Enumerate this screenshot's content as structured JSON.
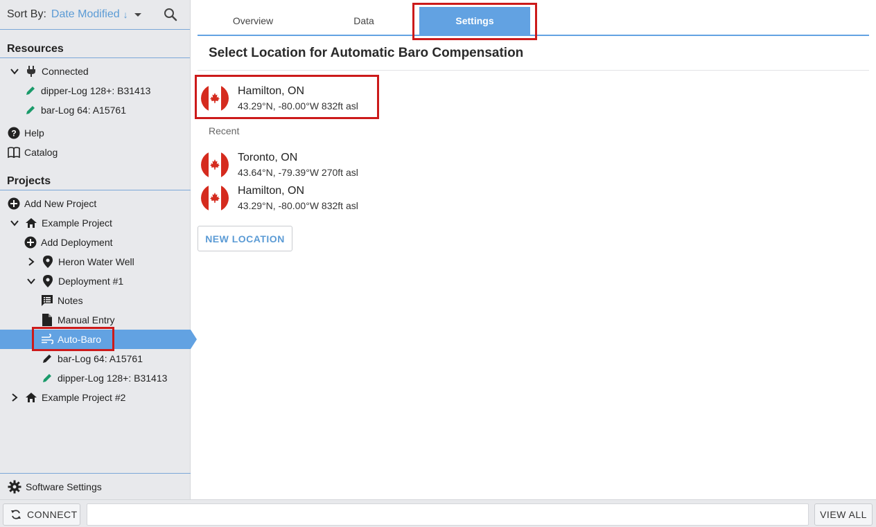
{
  "sortbar": {
    "label": "Sort By:",
    "value": "Date Modified",
    "direction_glyph": "↓"
  },
  "resources": {
    "title": "Resources",
    "connected_label": "Connected",
    "devices": [
      {
        "label": "dipper-Log 128+: B31413"
      },
      {
        "label": "bar-Log 64: A15761"
      }
    ],
    "help_label": "Help",
    "catalog_label": "Catalog"
  },
  "projects": {
    "title": "Projects",
    "add_project_label": "Add New Project",
    "example_project": "Example Project",
    "add_deployment_label": "Add Deployment",
    "heron_label": "Heron Water Well",
    "deployment_label": "Deployment #1",
    "notes_label": "Notes",
    "manual_entry_label": "Manual Entry",
    "auto_baro_label": "Auto-Baro",
    "deployment_devices": [
      {
        "label": "bar-Log 64: A15761"
      },
      {
        "label": "dipper-Log 128+: B31413"
      }
    ],
    "example_project_2": "Example Project #2"
  },
  "software_settings_label": "Software Settings",
  "bottombar": {
    "connect_label": "CONNECT",
    "view_all_label": "VIEW ALL"
  },
  "tabs": [
    {
      "label": "Overview"
    },
    {
      "label": "Data"
    },
    {
      "label": "Settings"
    }
  ],
  "main": {
    "title": "Select Location for Automatic Baro Compensation",
    "selected": {
      "name": "Hamilton, ON",
      "coords": "43.29°N, -80.00°W 832ft asl"
    },
    "recent_label": "Recent",
    "recent": [
      {
        "name": "Toronto, ON",
        "coords": "43.64°N, -79.39°W 270ft asl"
      },
      {
        "name": "Hamilton, ON",
        "coords": "43.29°N, -80.00°W 832ft asl"
      }
    ],
    "new_location_label": "NEW LOCATION"
  },
  "colors": {
    "accent": "#62a2e2",
    "highlight": "#cc1a1a",
    "canada_red": "#d52b1e",
    "edit_green": "#1a9a6a"
  }
}
